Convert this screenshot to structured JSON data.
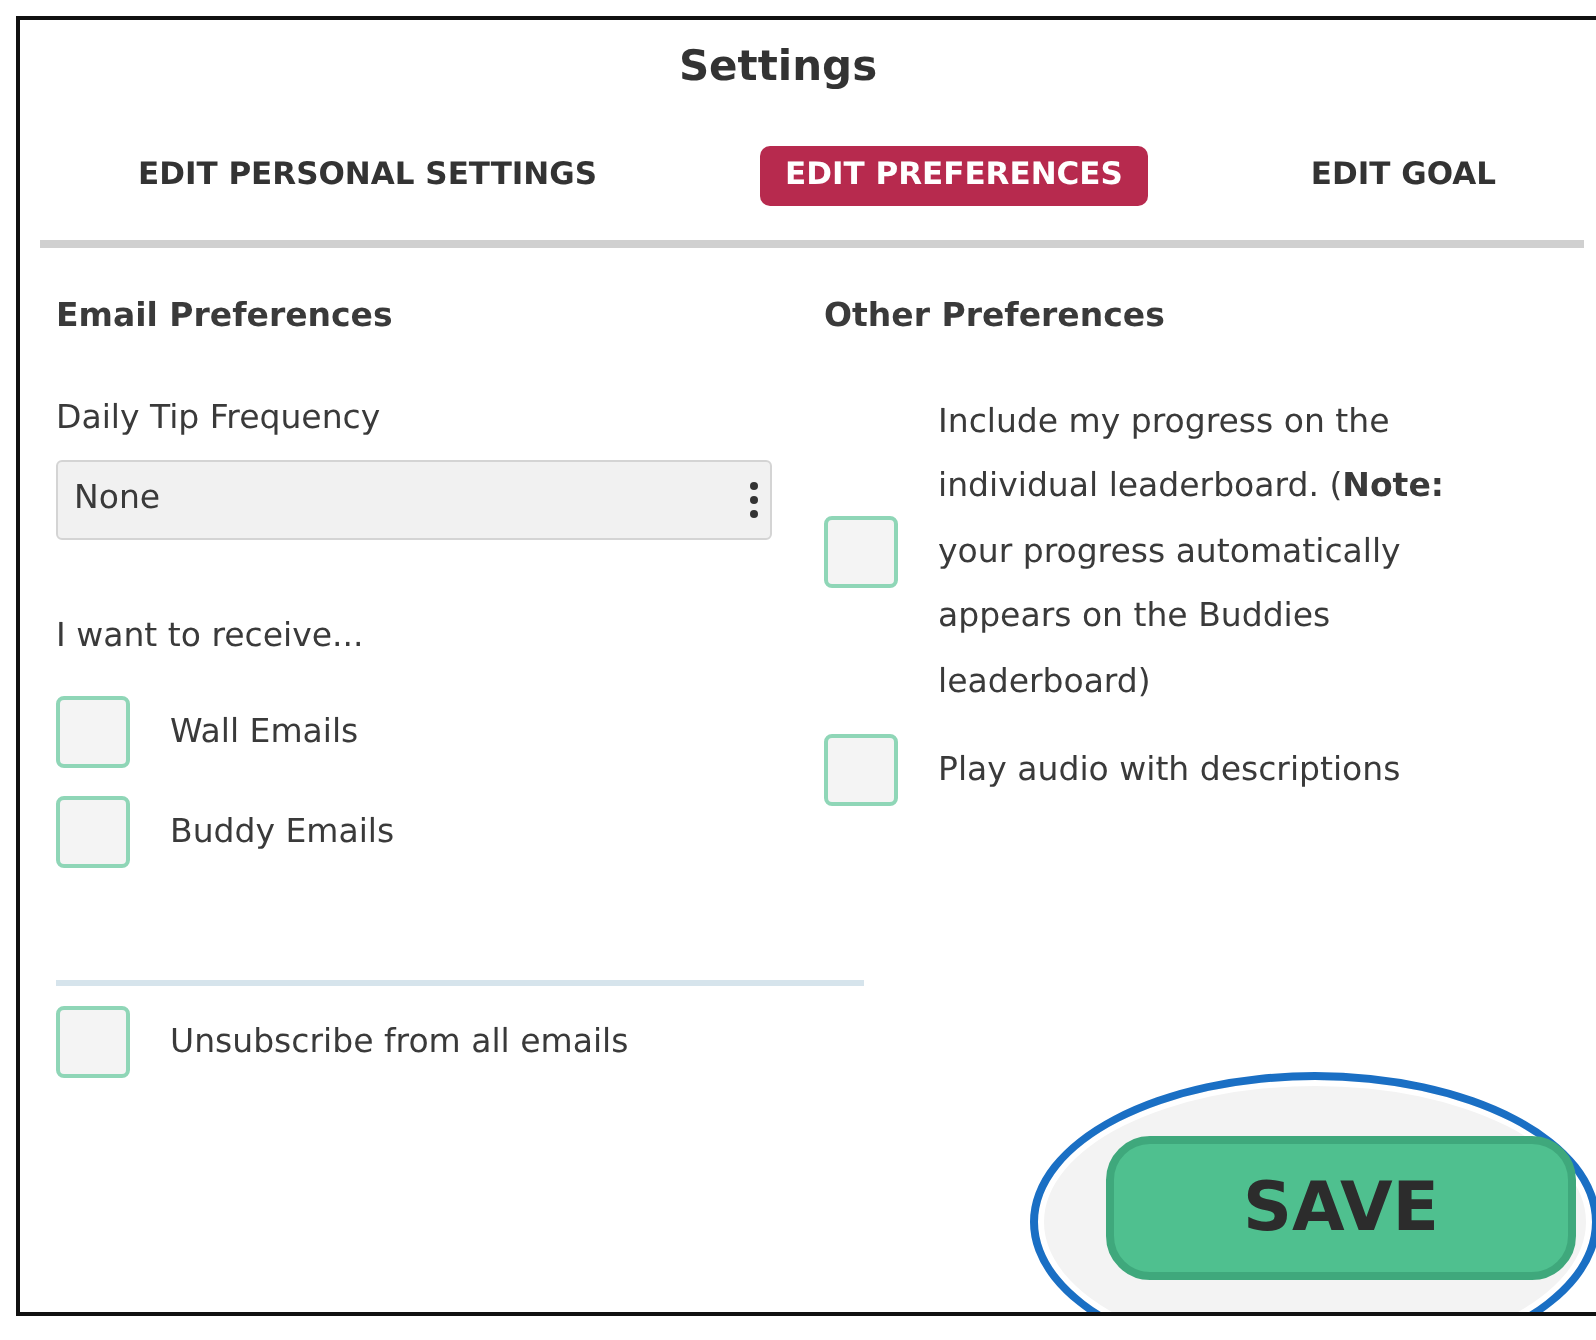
{
  "window": {
    "title": "Settings"
  },
  "tabs": [
    {
      "label": "EDIT PERSONAL SETTINGS",
      "selected": false
    },
    {
      "label": "EDIT PREFERENCES",
      "selected": true
    },
    {
      "label": "EDIT GOAL",
      "selected": false
    }
  ],
  "email_preferences": {
    "heading": "Email Preferences",
    "frequency_label": "Daily Tip Frequency",
    "frequency_value": "None",
    "receive_label": "I want to receive...",
    "options": [
      {
        "label": "Wall Emails",
        "checked": false
      },
      {
        "label": "Buddy Emails",
        "checked": false
      }
    ],
    "unsubscribe": {
      "label": "Unsubscribe from all emails",
      "checked": false
    }
  },
  "other_preferences": {
    "heading": "Other Preferences",
    "options": [
      {
        "label": "Include my progress on the individual leaderboard. (**Note:** your progress automatically appears on the Buddies leaderboard)",
        "checked": false
      },
      {
        "label": "Play audio with descriptions",
        "checked": false
      }
    ]
  },
  "save_button": {
    "label": "SAVE",
    "highlighted": true
  }
}
